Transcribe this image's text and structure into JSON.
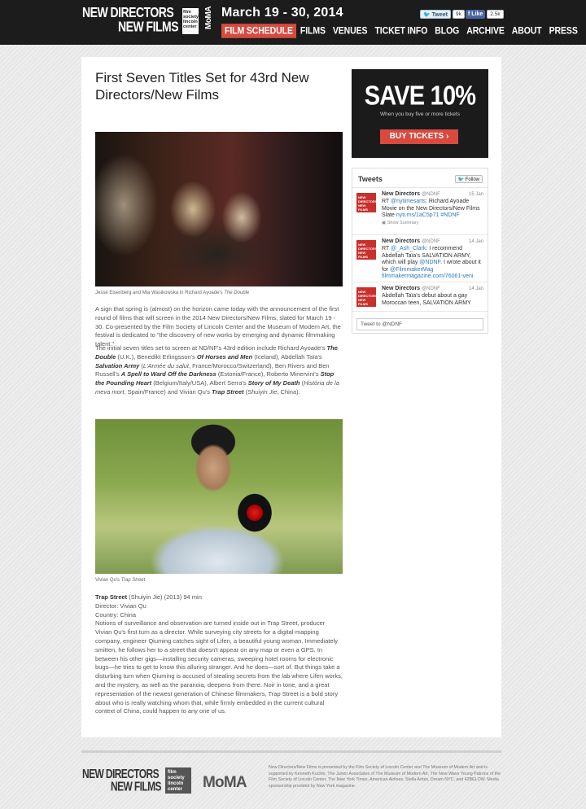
{
  "header": {
    "logo_line1": "NEW DIRECTORS",
    "logo_line2": "NEW FILMS",
    "fslc": "film society lincoln center",
    "moma": "MoMA",
    "dates": "March 19 - 30, 2014",
    "tweet_label": "Tweet",
    "tweet_count": "9k",
    "like_label": "Like",
    "like_count": "2.5k",
    "nav": [
      "FILM SCHEDULE",
      "FILMS",
      "VENUES",
      "TICKET INFO",
      "BLOG",
      "ARCHIVE",
      "ABOUT",
      "PRESS"
    ]
  },
  "article": {
    "title": "First Seven Titles Set for 43rd New Directors/New Films",
    "caption1_text": "Jesse Eisenberg and Mia Wasikowska in Richard Ayoade's ",
    "caption1_film": "The Double",
    "para1": "A sign that spring is (almost) on the horizon came today with the announcement of the first round of films that will screen in the 2014 New Directors/New Films, slated for March 19 - 30. Co-presented by the Film Society of Lincoln Center and the Museum of Modern Art, the festival is dedicated to \"the discovery of new works by emerging and dynamic filmmaking talent.\"",
    "para2": {
      "t1": "The initial seven titles set to screen at ND/NF's 43rd edition include Richard Ayoade's ",
      "f1": "The Double",
      "t2": " (U.K.), Benedikt Erlingsson's ",
      "f2": "Of Horses and Men",
      "t3": " (Iceland), Abdellah Taïa's ",
      "f3": "Salvation Army",
      "t4": " (",
      "f4": "L'Armée du salut",
      "t5": ", France/Morocco/Switzerland), Ben Rivers and Ben Russell's ",
      "f5": "A Spell to Ward Off the Darkness",
      "t6": " (Estonia/France), Roberto Minervini's ",
      "f6": "Stop the Pounding Heart",
      "t7": " (Belgium/Italy/USA), Albert Serra's ",
      "f7": "Story of My Death",
      "t8": " (",
      "f8": "Història de la meva mort",
      "t9": ", Spain/France) and Vivian Qu's ",
      "f9": "Trap Street",
      "t10": " (",
      "f10": "Shuiyin Jie",
      "t11": ", China)."
    },
    "caption2_text": "Vivian Qu's ",
    "caption2_film": "Trap Street",
    "film_title": "Trap Street",
    "film_meta": " (Shuiyin Jie) (2013) 94 min",
    "director": "Director: Vivian Qu",
    "country": "Country: China",
    "synopsis": "Notions of surveillance and observation are turned inside out in Trap Street, producer Vivian Qu's first turn as a director. While surveying city streets for a digital-mapping company, engineer Qiuming catches sight of Lifen, a beautiful young woman. Immediately smitten, he follows her to a street that doesn't appear on any map or even a GPS. In between his other gigs—installing security cameras, sweeping hotel rooms for electronic bugs—he tries to get to know this alluring stranger. And he does—sort of. But things take a disturbing turn when Qiuming is accused of stealing secrets from the lab where Lifen works, and the mystery, as well as the paranoia, deepens from there. Noir in tone, and a great representation of the newest generation of Chinese filmmakers, Trap Street is a bold story about who is really watching whom that, while firmly embedded in the current cultural context of China, could happen to any one of us."
  },
  "ad": {
    "headline": "SAVE 10%",
    "sub": "When you buy five or more tickets",
    "button": "BUY TICKETS ›"
  },
  "tweets": {
    "heading": "Tweets",
    "follow": "Follow",
    "input_placeholder": "Tweet to @NDNF",
    "items": [
      {
        "name": "New Directors",
        "handle": "@NDNF",
        "date": "15 Jan",
        "pre": "RT ",
        "link1": "@nytimesarts",
        "mid": ": Richard Ayoade Movie on the New Directors/New Films Slate ",
        "link2": "nyti.ms/1aC5p71 #NDNF",
        "summary": "Show Summary"
      },
      {
        "name": "New Directors",
        "handle": "@NDNF",
        "date": "14 Jan",
        "pre": "RT ",
        "link1": "@_Ash_Clark",
        "mid": ": I recommend Abdellah Taïa's SALVATION ARMY, which will play ",
        "link2": "@NDNF",
        "post": ". I wrote about it for ",
        "link3": "@FilmmakerMag",
        "link4": " filmmakermagazine.com/76061-veni"
      },
      {
        "name": "New Directors",
        "handle": "@NDNF",
        "date": "14 Jan",
        "text": "Abdellah Taïa's debut about a gay Moroccan teen, SALVATION ARMY"
      }
    ]
  },
  "footer": {
    "logo_line1": "NEW DIRECTORS",
    "logo_line2": "NEW FILMS",
    "fslc": "film society lincoln center",
    "moma": "MoMA",
    "text": "New Directors/New Films is presented by the Film Society of Lincoln Center and The Museum of Modern Art and is supported by Kenneth Kuchin, The Junior Associates of The Museum of Modern Art, The New Wave Young Patrons of the Film Society of Lincoln Center, The New York Times, American Airlines, Stella Artois, Dream NYC, and 42BELOW. Media sponsorship provided by New York magazine."
  },
  "colors": {
    "accent": "#d84a3f",
    "header_bg": "#1c1c1c",
    "link": "#2b7bb9"
  }
}
